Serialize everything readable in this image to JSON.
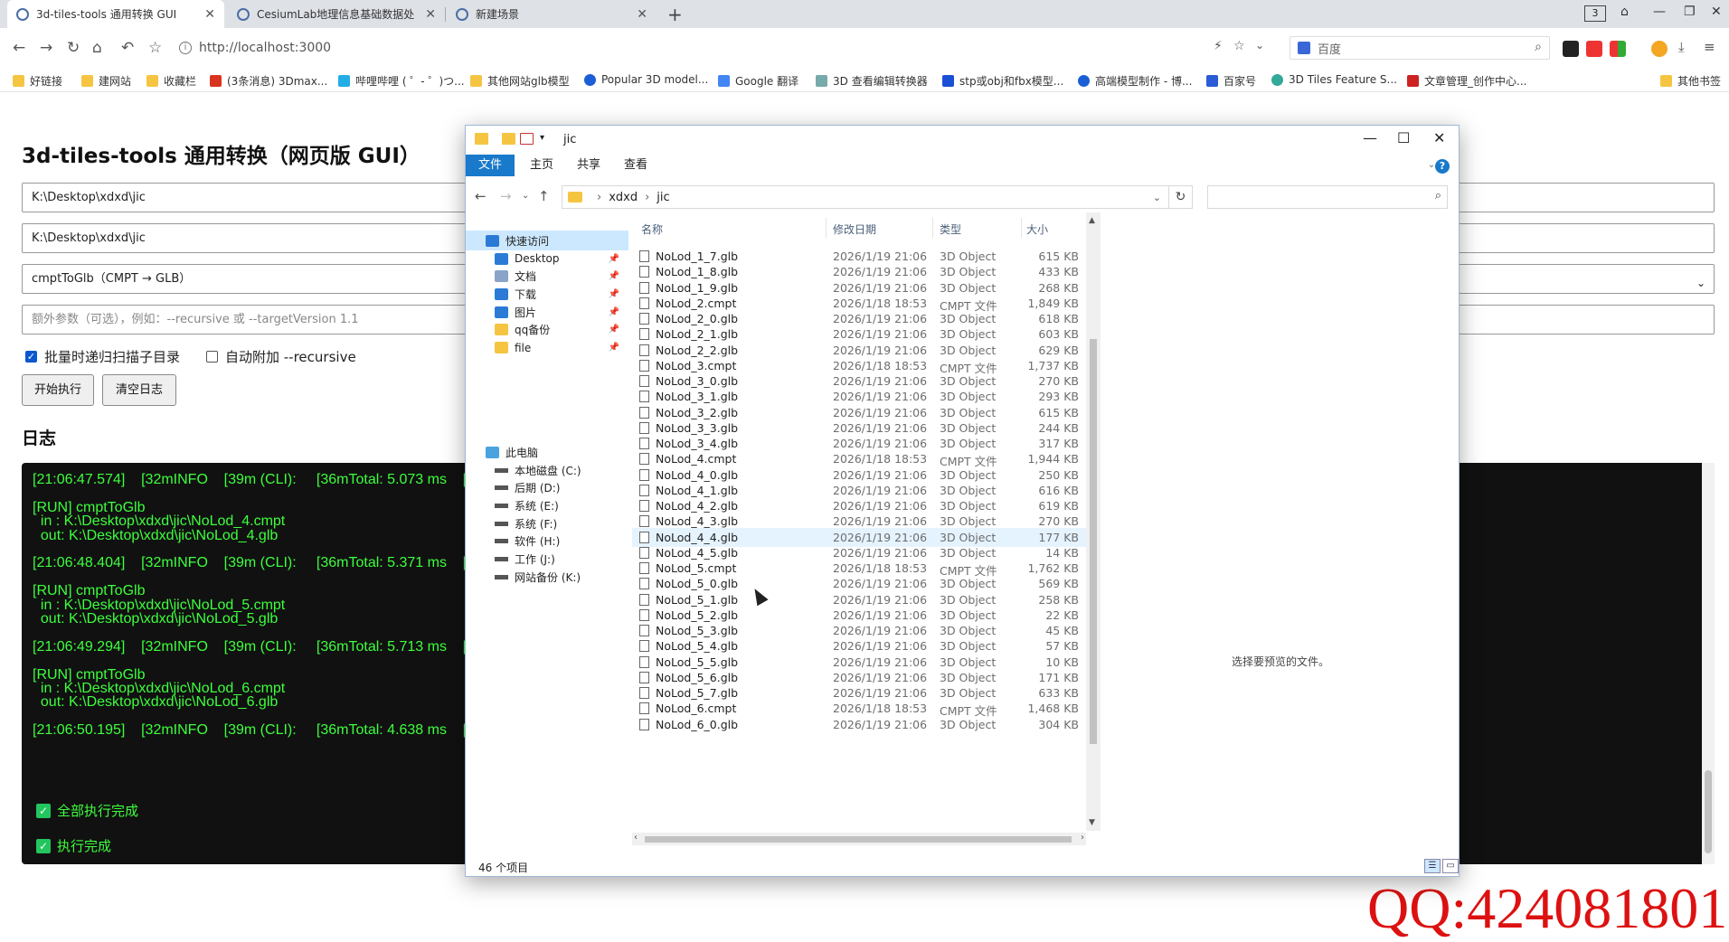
{
  "browser": {
    "tabs": [
      {
        "title": "3d-tiles-tools 通用转换 GUI",
        "active": true
      },
      {
        "title": "CesiumLab地理信息基础数据处",
        "active": false
      },
      {
        "title": "新建场景",
        "active": false
      }
    ],
    "new_tab": "+",
    "tab_count": "3",
    "url": "http://localhost:3000",
    "search_engine": "百度",
    "bookmarks": [
      "好链接",
      "建网站",
      "收藏栏",
      "(3条消息) 3Dmax...",
      "哔哩哔哩 ( ゜- ゜)つ...",
      "其他网站glb模型",
      "Popular 3D model...",
      "Google 翻译",
      "3D 查看编辑转换器",
      "stp或obj和fbx模型...",
      "高端模型制作 - 博...",
      "百家号",
      "3D Tiles Feature S...",
      "文章管理_创作中心..."
    ],
    "other_bookmarks": "其他书签"
  },
  "page": {
    "title": "3d-tiles-tools 通用转换（网页版 GUI）",
    "input_path": "K:\\Desktop\\xdxd\\jic",
    "output_path": "K:\\Desktop\\xdxd\\jic",
    "command": "cmptToGlb（CMPT → GLB）",
    "extra_placeholder": "额外参数（可选），例如：--recursive 或 --targetVersion 1.1",
    "options": [
      {
        "label": "批量时递归扫描子目录",
        "checked": true
      },
      {
        "label": "自动附加 --recursive",
        "checked": false
      }
    ],
    "run_button": "开始执行",
    "clear_button": "清空日志",
    "log_heading": "日志",
    "log_lines": [
      "[21:06:47.574]    [32mINFO    [39m (CLI):     [36mTotal: 5.073 ms    [",
      "",
      "[RUN] cmptToGlb",
      "  in : K:\\Desktop\\xdxd\\jic\\NoLod_4.cmpt",
      "  out: K:\\Desktop\\xdxd\\jic\\NoLod_4.glb",
      "",
      "[21:06:48.404]    [32mINFO    [39m (CLI):     [36mTotal: 5.371 ms    [",
      "",
      "[RUN] cmptToGlb",
      "  in : K:\\Desktop\\xdxd\\jic\\NoLod_5.cmpt",
      "  out: K:\\Desktop\\xdxd\\jic\\NoLod_5.glb",
      "",
      "[21:06:49.294]    [32mINFO    [39m (CLI):     [36mTotal: 5.713 ms    [",
      "",
      "[RUN] cmptToGlb",
      "  in : K:\\Desktop\\xdxd\\jic\\NoLod_6.cmpt",
      "  out: K:\\Desktop\\xdxd\\jic\\NoLod_6.glb",
      "",
      "[21:06:50.195]    [32mINFO    [39m (CLI):     [36mTotal: 4.638 ms    ["
    ],
    "done_lines": [
      "全部执行完成",
      "执行完成"
    ]
  },
  "explorer": {
    "title": "jic",
    "ribbon_tabs": [
      "文件",
      "主页",
      "共享",
      "查看"
    ],
    "breadcrumb": [
      "xdxd",
      "jic"
    ],
    "nav": {
      "quick_access": "快速访问",
      "quick_items": [
        "Desktop",
        "文档",
        "下载",
        "图片",
        "qq备份",
        "file"
      ],
      "this_pc": "此电脑",
      "drives": [
        "本地磁盘 (C:)",
        "后期 (D:)",
        "系统 (E:)",
        "系统 (F:)",
        "软件 (H:)",
        "工作 (J:)",
        "网站备份 (K:)"
      ]
    },
    "columns": [
      "名称",
      "修改日期",
      "类型",
      "大小"
    ],
    "files": [
      [
        "NoLod_1_7.glb",
        "2026/1/19 21:06",
        "3D Object",
        "615 KB"
      ],
      [
        "NoLod_1_8.glb",
        "2026/1/19 21:06",
        "3D Object",
        "433 KB"
      ],
      [
        "NoLod_1_9.glb",
        "2026/1/19 21:06",
        "3D Object",
        "268 KB"
      ],
      [
        "NoLod_2.cmpt",
        "2026/1/18 18:53",
        "CMPT 文件",
        "1,849 KB"
      ],
      [
        "NoLod_2_0.glb",
        "2026/1/19 21:06",
        "3D Object",
        "618 KB"
      ],
      [
        "NoLod_2_1.glb",
        "2026/1/19 21:06",
        "3D Object",
        "603 KB"
      ],
      [
        "NoLod_2_2.glb",
        "2026/1/19 21:06",
        "3D Object",
        "629 KB"
      ],
      [
        "NoLod_3.cmpt",
        "2026/1/18 18:53",
        "CMPT 文件",
        "1,737 KB"
      ],
      [
        "NoLod_3_0.glb",
        "2026/1/19 21:06",
        "3D Object",
        "270 KB"
      ],
      [
        "NoLod_3_1.glb",
        "2026/1/19 21:06",
        "3D Object",
        "293 KB"
      ],
      [
        "NoLod_3_2.glb",
        "2026/1/19 21:06",
        "3D Object",
        "615 KB"
      ],
      [
        "NoLod_3_3.glb",
        "2026/1/19 21:06",
        "3D Object",
        "244 KB"
      ],
      [
        "NoLod_3_4.glb",
        "2026/1/19 21:06",
        "3D Object",
        "317 KB"
      ],
      [
        "NoLod_4.cmpt",
        "2026/1/18 18:53",
        "CMPT 文件",
        "1,944 KB"
      ],
      [
        "NoLod_4_0.glb",
        "2026/1/19 21:06",
        "3D Object",
        "250 KB"
      ],
      [
        "NoLod_4_1.glb",
        "2026/1/19 21:06",
        "3D Object",
        "616 KB"
      ],
      [
        "NoLod_4_2.glb",
        "2026/1/19 21:06",
        "3D Object",
        "619 KB"
      ],
      [
        "NoLod_4_3.glb",
        "2026/1/19 21:06",
        "3D Object",
        "270 KB"
      ],
      [
        "NoLod_4_4.glb",
        "2026/1/19 21:06",
        "3D Object",
        "177 KB"
      ],
      [
        "NoLod_4_5.glb",
        "2026/1/19 21:06",
        "3D Object",
        "14 KB"
      ],
      [
        "NoLod_5.cmpt",
        "2026/1/18 18:53",
        "CMPT 文件",
        "1,762 KB"
      ],
      [
        "NoLod_5_0.glb",
        "2026/1/19 21:06",
        "3D Object",
        "569 KB"
      ],
      [
        "NoLod_5_1.glb",
        "2026/1/19 21:06",
        "3D Object",
        "258 KB"
      ],
      [
        "NoLod_5_2.glb",
        "2026/1/19 21:06",
        "3D Object",
        "22 KB"
      ],
      [
        "NoLod_5_3.glb",
        "2026/1/19 21:06",
        "3D Object",
        "45 KB"
      ],
      [
        "NoLod_5_4.glb",
        "2026/1/19 21:06",
        "3D Object",
        "57 KB"
      ],
      [
        "NoLod_5_5.glb",
        "2026/1/19 21:06",
        "3D Object",
        "10 KB"
      ],
      [
        "NoLod_5_6.glb",
        "2026/1/19 21:06",
        "3D Object",
        "171 KB"
      ],
      [
        "NoLod_5_7.glb",
        "2026/1/19 21:06",
        "3D Object",
        "633 KB"
      ],
      [
        "NoLod_6.cmpt",
        "2026/1/18 18:53",
        "CMPT 文件",
        "1,468 KB"
      ],
      [
        "NoLod_6_0.glb",
        "2026/1/19 21:06",
        "3D Object",
        "304 KB"
      ]
    ],
    "hovered_file": "NoLod_4_4.glb",
    "preview_message": "选择要预览的文件。",
    "status": "46 个项目"
  },
  "watermark": "QQ:424081801",
  "colors": {
    "log_bg": "#111111",
    "log_text": "#3dff3d",
    "ribbon_file": "#1979ca",
    "watermark": "#dd1111"
  }
}
